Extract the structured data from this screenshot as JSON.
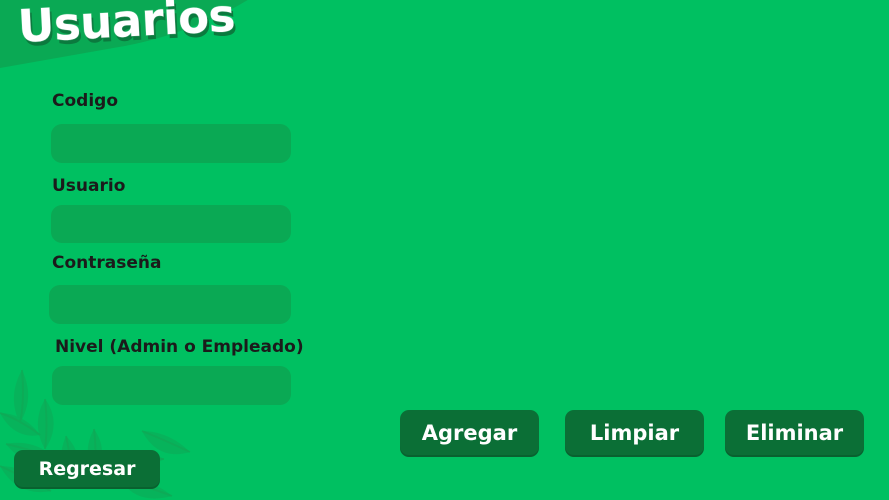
{
  "header": {
    "title": "Usuarios"
  },
  "form": {
    "codigo": {
      "label": "Codigo",
      "value": "",
      "placeholder": ""
    },
    "usuario": {
      "label": "Usuario",
      "value": "",
      "placeholder": ""
    },
    "contrasena": {
      "label": "Contraseña",
      "value": "",
      "placeholder": ""
    },
    "nivel": {
      "label": "Nivel (Admin o Empleado)",
      "value": "",
      "placeholder": ""
    }
  },
  "actions": {
    "agregar": "Agregar",
    "limpiar": "Limpiar",
    "eliminar": "Eliminar",
    "regresar": "Regresar"
  },
  "colors": {
    "background": "#00c061",
    "field": "#0aa954",
    "button": "#0b6f36",
    "label": "#1b1b1b",
    "title": "#ffffff"
  },
  "icons": {
    "decoration": "leaf-decoration-icon"
  }
}
